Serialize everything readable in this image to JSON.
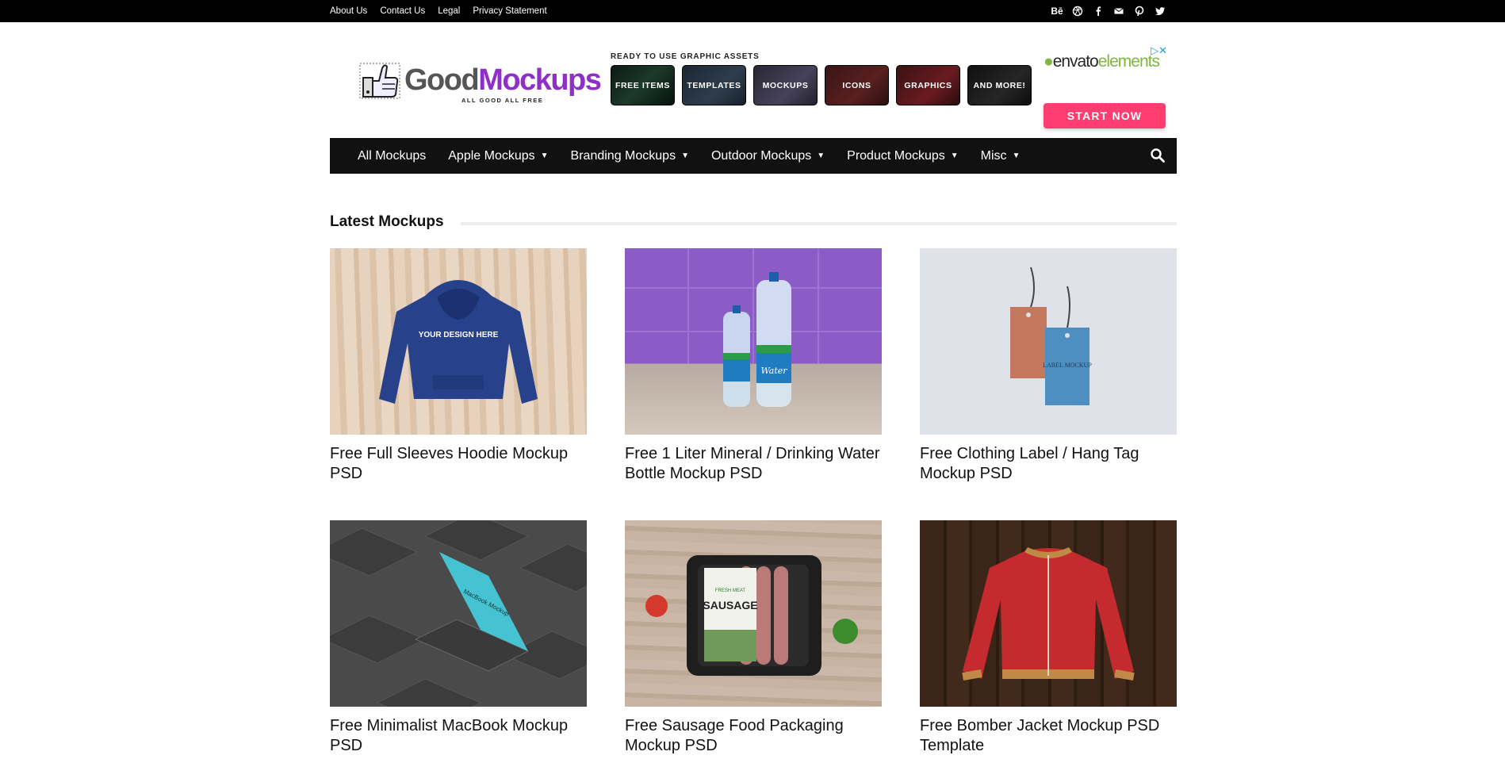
{
  "topbar": {
    "links": [
      "About Us",
      "Contact Us",
      "Legal",
      "Privacy Statement"
    ],
    "social": [
      "behance-icon",
      "dribbble-icon",
      "facebook-icon",
      "mail-icon",
      "pinterest-icon",
      "twitter-icon"
    ],
    "behance_text": "Bē"
  },
  "logo": {
    "good": "Good",
    "mockups": "Mockups",
    "tagline": "ALL GOOD ALL FREE"
  },
  "assets": {
    "title": "READY TO USE GRAPHIC ASSETS",
    "tiles": [
      "FREE ITEMS",
      "TEMPLATES",
      "MOCKUPS",
      "ICONS",
      "GRAPHICS",
      "AND MORE!"
    ]
  },
  "ad": {
    "badge": "▷✕",
    "brand_envato": "envato",
    "brand_elements": "elements",
    "cta": "START NOW"
  },
  "nav": {
    "items": [
      "All Mockups",
      "Apple Mockups",
      "Branding Mockups",
      "Outdoor Mockups",
      "Product Mockups",
      "Misc"
    ],
    "chevron": "⌄"
  },
  "section": {
    "title": "Latest Mockups"
  },
  "cards": [
    {
      "title": "Free Full Sleeves Hoodie Mockup PSD",
      "design_text": "YOUR DESIGN HERE"
    },
    {
      "title": "Free 1 Liter Mineral / Drinking Water Bottle Mockup PSD",
      "label_text": "Water"
    },
    {
      "title": "Free Clothing Label / Hang Tag Mockup PSD",
      "label_text": "LABEL MOCKUP"
    },
    {
      "title": "Free Minimalist MacBook Mockup PSD",
      "screen_text": "MacBook Mockup"
    },
    {
      "title": "Free Sausage Food Packaging Mockup PSD",
      "label_text": "SAUSAGE",
      "label_top": "FRESH MEAT"
    },
    {
      "title": "Free Bomber Jacket Mockup PSD Template"
    }
  ]
}
